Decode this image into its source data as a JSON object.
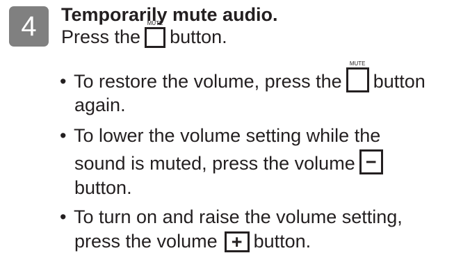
{
  "step": {
    "number": "4",
    "heading": "Temporarily mute audio.",
    "intro_before": "Press the",
    "intro_after": "button.",
    "mute_caption": "MUTE"
  },
  "bullets": [
    {
      "bullet": "•",
      "before": "To restore the volume, press the",
      "after": "button",
      "line2": "again."
    },
    {
      "bullet": "•",
      "line1": "To lower the volume setting while the",
      "before": "sound is muted, press the volume",
      "symbol": "−",
      "line3": "button."
    },
    {
      "bullet": "•",
      "line1": "To turn on and raise the volume setting,",
      "before": "press the volume",
      "symbol": "+",
      "after": "button."
    }
  ]
}
